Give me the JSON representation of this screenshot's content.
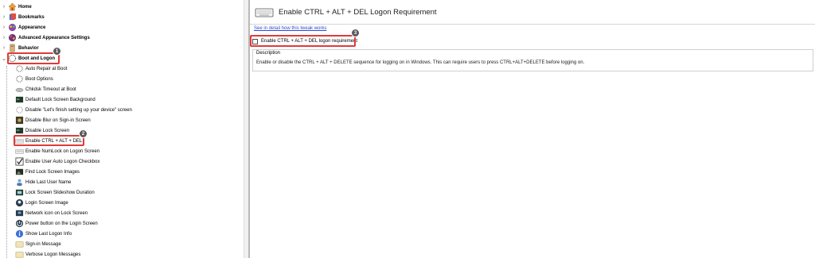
{
  "tree": {
    "categories": [
      {
        "label": "Home",
        "icon": "home-icon"
      },
      {
        "label": "Bookmarks",
        "icon": "bookmark-icon"
      },
      {
        "label": "Appearance",
        "icon": "appearance-icon"
      },
      {
        "label": "Advanced Appearance Settings",
        "icon": "advanced-appearance-icon"
      },
      {
        "label": "Behavior",
        "icon": "behavior-icon"
      },
      {
        "label": "Boot and Logon",
        "icon": "boot-logon-icon"
      }
    ],
    "children": [
      {
        "label": "Auto Repair at Boot",
        "icon": "dotted-circle-icon"
      },
      {
        "label": "Boot Options",
        "icon": "dotted-circle-icon"
      },
      {
        "label": "Chkdsk Timeout at Boot",
        "icon": "disk-icon"
      },
      {
        "label": "Default Lock Screen Background",
        "icon": "screen-icon"
      },
      {
        "label": "Disable \"Let's finish setting up your device\" screen",
        "icon": "dotted-circle-icon"
      },
      {
        "label": "Disable Blur on Sign-in Screen",
        "icon": "blur-icon"
      },
      {
        "label": "Disable Lock Screen",
        "icon": "screen-icon"
      },
      {
        "label": "Enable CTRL + ALT + DEL",
        "icon": "keyboard-icon"
      },
      {
        "label": "Enable NumLock on Logon Screen",
        "icon": "keyboard-icon"
      },
      {
        "label": "Enable User Auto Logon Checkbox",
        "icon": "checkbox-icon"
      },
      {
        "label": "Find Lock Screen Images",
        "icon": "images-icon"
      },
      {
        "label": "Hide Last User Name",
        "icon": "user-icon"
      },
      {
        "label": "Lock Screen Slideshow Duration",
        "icon": "slideshow-icon"
      },
      {
        "label": "Login Screen Image",
        "icon": "person-icon"
      },
      {
        "label": "Network icon on Lock Screen",
        "icon": "network-icon"
      },
      {
        "label": "Power button on the Login Screen",
        "icon": "power-icon"
      },
      {
        "label": "Show Last Logon Info",
        "icon": "info-icon"
      },
      {
        "label": "Sign-in Message",
        "icon": "message-icon"
      },
      {
        "label": "Verbose Logon Messages",
        "icon": "message-icon"
      }
    ]
  },
  "badges": {
    "one": "1",
    "two": "2",
    "three": "3"
  },
  "detail": {
    "title": "Enable CTRL + ALT + DEL Logon Requirement",
    "link": "See in detail how this tweak works",
    "checkbox_label": "Enable CTRL + ALT + DEL logon requirement",
    "checked": false,
    "description_title": "Description",
    "description": "Enable or disable the CTRL + ALT + DELETE sequence for logging on in Windows. This can require users to press CTRL+ALT+DELETE before logging on."
  },
  "colors": {
    "highlight": "#e03a3a",
    "link": "#2f4ad6",
    "badge": "#5a5a5a"
  }
}
